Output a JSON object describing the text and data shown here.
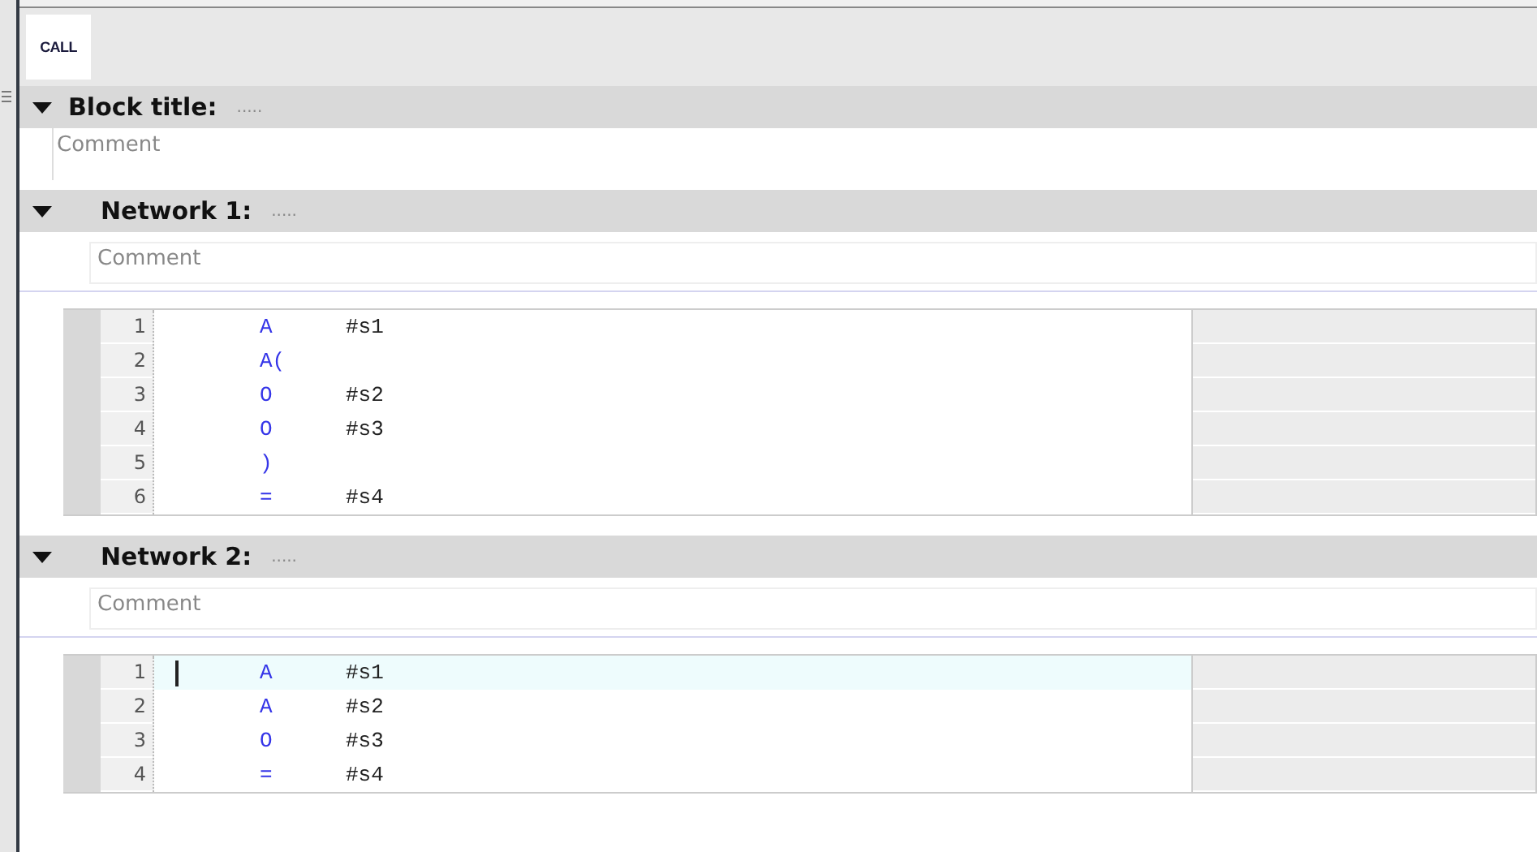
{
  "toolbar": {
    "buttons": [
      "CALL"
    ]
  },
  "block": {
    "title": "Block title:",
    "dots": ".....",
    "expanded": true,
    "comment": "Comment"
  },
  "networks": [
    {
      "title": "Network 1:",
      "dots": ".....",
      "expanded": true,
      "comment": "Comment",
      "lines": [
        {
          "number": "1",
          "op": "A",
          "operand": "#s1",
          "selected": false
        },
        {
          "number": "2",
          "op": "A(",
          "selected": false
        },
        {
          "number": "3",
          "op": "O",
          "operand": "#s2",
          "selected": false
        },
        {
          "number": "4",
          "op": "O",
          "operand": "#s3",
          "selected": false
        },
        {
          "number": "5",
          "op": ")",
          "selected": false
        },
        {
          "number": "6",
          "op": "=",
          "operand": "#s4",
          "selected": false
        }
      ]
    },
    {
      "title": "Network 2:",
      "dots": ".....",
      "expanded": true,
      "comment": "Comment",
      "lines": [
        {
          "number": "1",
          "op": "A",
          "operand": "#s1",
          "selected": true
        },
        {
          "number": "2",
          "op": "A",
          "operand": "#s2",
          "selected": false
        },
        {
          "number": "3",
          "op": "O",
          "operand": "#s3",
          "selected": false
        },
        {
          "number": "4",
          "op": "=",
          "operand": "#s4",
          "selected": false
        }
      ]
    }
  ]
}
